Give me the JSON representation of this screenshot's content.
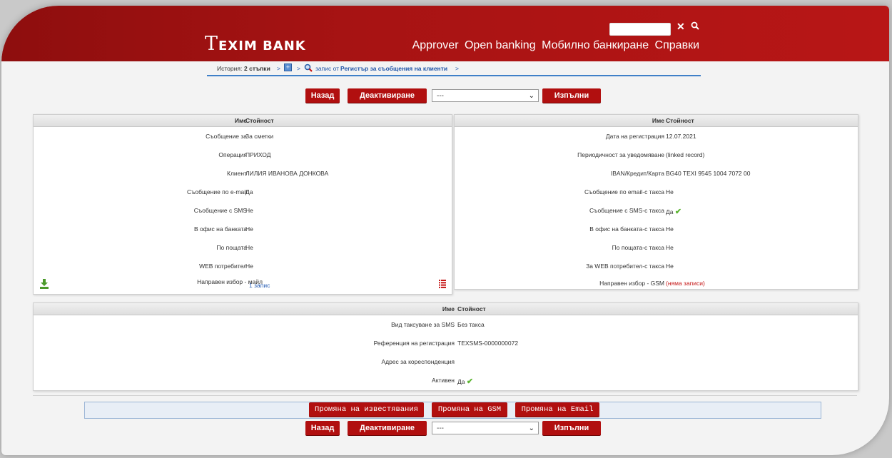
{
  "header": {
    "logo_T": "T",
    "logo_rest": "EXIM BANK",
    "nav": [
      "Approver",
      "Open banking",
      "Мобилно банкиране",
      "Справки"
    ],
    "close_icon": "✕",
    "search_icon": "⚲"
  },
  "breadcrumb": {
    "history_label": "История:",
    "steps": "2 стъпки",
    "sep": ">",
    "record_text": "запис от",
    "registry": "Регистър за съобщения на клиенти"
  },
  "actions": {
    "back": "Назад",
    "deactivate": "Деактивиране",
    "select_value": "---",
    "execute": "Изпълни"
  },
  "panel_left": {
    "head_name": "Име",
    "head_value": "Стойност",
    "rows": [
      {
        "label": "Съобщение за",
        "value": "За сметки"
      },
      {
        "label": "Операция",
        "value": "ПРИХОД"
      },
      {
        "label": "Клиент",
        "value": "ЛИЛИЯ ИВАНОВА ДОНКОВА"
      },
      {
        "label": "Съобщение по e-mail",
        "value": "Да"
      },
      {
        "label": "Съобщение с SMS",
        "value": "Не"
      },
      {
        "label": "В офис на банката",
        "value": "Не"
      },
      {
        "label": "По пощата",
        "value": "Не"
      },
      {
        "label": "WEB потребител",
        "value": "Не"
      },
      {
        "label": "Направен избор - майл",
        "value": "1 запис"
      }
    ]
  },
  "panel_right": {
    "head_name": "Име",
    "head_value": "Стойност",
    "rows": [
      {
        "label": "Дата на регистрация",
        "value": "12.07.2021"
      },
      {
        "label": "Периодичност за уведомяване",
        "value": "(linked record)"
      },
      {
        "label": "IBAN/Кредит/Карта",
        "value": "BG40 TEXI 9545 1004 7072 00"
      },
      {
        "label": "Съобщение по email-с такса",
        "value": "Не"
      },
      {
        "label": "Съобщение с SMS-с такса",
        "value": "Да"
      },
      {
        "label": "В офис на банката-с такса",
        "value": "Не"
      },
      {
        "label": "По пощата-с такса",
        "value": "Не"
      },
      {
        "label": "За WEB потребител-с такса",
        "value": "Не"
      },
      {
        "label": "Направен избор - GSM",
        "value": "(няма записи)"
      }
    ]
  },
  "panel_bottom": {
    "head_name": "Име",
    "head_value": "Стойност",
    "rows": [
      {
        "label": "Вид таксуване за SMS",
        "value": "Без такса"
      },
      {
        "label": "Референция на регистрация",
        "value": "TEXSMS-0000000072"
      },
      {
        "label": "Адрес за кореспонденция",
        "value": ""
      },
      {
        "label": "Активен",
        "value": "Да"
      }
    ]
  },
  "footer": {
    "change_notifications": "Промяна на известявания",
    "change_gsm": "Промяна на GSM",
    "change_email": "Промяна на Email"
  },
  "colors": {
    "brand_red": "#b10f0f",
    "check_green": "#5cb531"
  }
}
